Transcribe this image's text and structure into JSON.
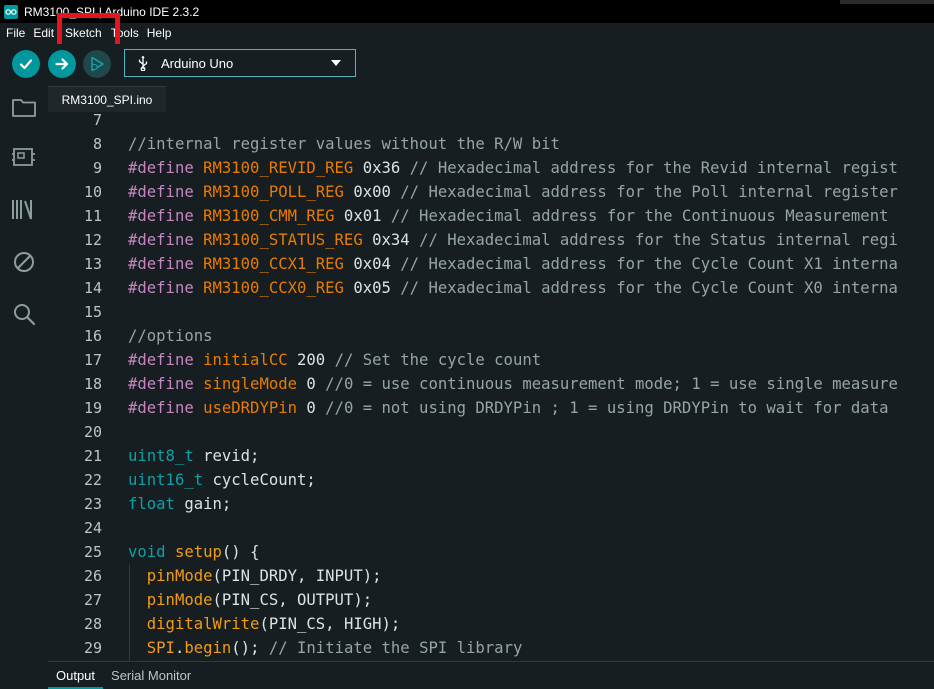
{
  "window": {
    "title": "RM3100_SPI | Arduino IDE 2.3.2"
  },
  "menu": {
    "items": [
      {
        "label": "File"
      },
      {
        "label": "Edit"
      },
      {
        "label": "Sketch"
      },
      {
        "label": "Tools"
      },
      {
        "label": "Help"
      }
    ],
    "highlighted": "Sketch"
  },
  "toolbar": {
    "verify": "verify-icon",
    "upload": "upload-arrow-icon",
    "debug": "debug-icon",
    "board": "Arduino Uno"
  },
  "sidebar": {
    "icons": [
      "folder-icon",
      "board-icon",
      "library-icon",
      "debug-icon",
      "search-icon"
    ]
  },
  "tabs": [
    {
      "label": "RM3100_SPI.ino"
    }
  ],
  "editor": {
    "lines": [
      {
        "n": "7",
        "segs": []
      },
      {
        "n": "8",
        "segs": [
          {
            "c": "cm",
            "t": "//internal register values without the R/W bit"
          }
        ]
      },
      {
        "n": "9",
        "segs": [
          {
            "c": "dir",
            "t": "#define "
          },
          {
            "c": "def",
            "t": "RM3100_REVID_REG"
          },
          {
            "c": "",
            "t": " 0x36 "
          },
          {
            "c": "cm",
            "t": "// Hexadecimal address for the Revid internal regist"
          }
        ]
      },
      {
        "n": "10",
        "segs": [
          {
            "c": "dir",
            "t": "#define "
          },
          {
            "c": "def",
            "t": "RM3100_POLL_REG"
          },
          {
            "c": "",
            "t": " 0x00 "
          },
          {
            "c": "cm",
            "t": "// Hexadecimal address for the Poll internal register"
          }
        ]
      },
      {
        "n": "11",
        "segs": [
          {
            "c": "dir",
            "t": "#define "
          },
          {
            "c": "def",
            "t": "RM3100_CMM_REG"
          },
          {
            "c": "",
            "t": " 0x01 "
          },
          {
            "c": "cm",
            "t": "// Hexadecimal address for the Continuous Measurement"
          }
        ]
      },
      {
        "n": "12",
        "segs": [
          {
            "c": "dir",
            "t": "#define "
          },
          {
            "c": "def",
            "t": "RM3100_STATUS_REG"
          },
          {
            "c": "",
            "t": " 0x34 "
          },
          {
            "c": "cm",
            "t": "// Hexadecimal address for the Status internal regi"
          }
        ]
      },
      {
        "n": "13",
        "segs": [
          {
            "c": "dir",
            "t": "#define "
          },
          {
            "c": "def",
            "t": "RM3100_CCX1_REG"
          },
          {
            "c": "",
            "t": " 0x04 "
          },
          {
            "c": "cm",
            "t": "// Hexadecimal address for the Cycle Count X1 interna"
          }
        ]
      },
      {
        "n": "14",
        "segs": [
          {
            "c": "dir",
            "t": "#define "
          },
          {
            "c": "def",
            "t": "RM3100_CCX0_REG"
          },
          {
            "c": "",
            "t": " 0x05 "
          },
          {
            "c": "cm",
            "t": "// Hexadecimal address for the Cycle Count X0 interna"
          }
        ]
      },
      {
        "n": "15",
        "segs": []
      },
      {
        "n": "16",
        "segs": [
          {
            "c": "cm",
            "t": "//options"
          }
        ]
      },
      {
        "n": "17",
        "segs": [
          {
            "c": "dir",
            "t": "#define "
          },
          {
            "c": "def",
            "t": "initialCC"
          },
          {
            "c": "",
            "t": " 200 "
          },
          {
            "c": "cm",
            "t": "// Set the cycle count"
          }
        ]
      },
      {
        "n": "18",
        "segs": [
          {
            "c": "dir",
            "t": "#define "
          },
          {
            "c": "def",
            "t": "singleMode"
          },
          {
            "c": "",
            "t": " 0 "
          },
          {
            "c": "cm",
            "t": "//0 = use continuous measurement mode; 1 = use single measure"
          }
        ]
      },
      {
        "n": "19",
        "segs": [
          {
            "c": "dir",
            "t": "#define "
          },
          {
            "c": "def",
            "t": "useDRDYPin"
          },
          {
            "c": "",
            "t": " 0 "
          },
          {
            "c": "cm",
            "t": "//0 = not using DRDYPin ; 1 = using DRDYPin to wait for data"
          }
        ]
      },
      {
        "n": "20",
        "segs": []
      },
      {
        "n": "21",
        "segs": [
          {
            "c": "kw",
            "t": "uint8_t"
          },
          {
            "c": "",
            "t": " revid;"
          }
        ]
      },
      {
        "n": "22",
        "segs": [
          {
            "c": "kw",
            "t": "uint16_t"
          },
          {
            "c": "",
            "t": " cycleCount;"
          }
        ]
      },
      {
        "n": "23",
        "segs": [
          {
            "c": "kw",
            "t": "float"
          },
          {
            "c": "",
            "t": " gain;"
          }
        ]
      },
      {
        "n": "24",
        "segs": []
      },
      {
        "n": "25",
        "segs": [
          {
            "c": "kw",
            "t": "void"
          },
          {
            "c": "",
            "t": " "
          },
          {
            "c": "fn",
            "t": "setup"
          },
          {
            "c": "",
            "t": "() {"
          }
        ]
      },
      {
        "n": "26",
        "segs": [
          {
            "c": "",
            "t": "  "
          },
          {
            "c": "fn",
            "t": "pinMode"
          },
          {
            "c": "",
            "t": "(PIN_DRDY, INPUT);"
          }
        ]
      },
      {
        "n": "27",
        "segs": [
          {
            "c": "",
            "t": "  "
          },
          {
            "c": "fn",
            "t": "pinMode"
          },
          {
            "c": "",
            "t": "(PIN_CS, OUTPUT);"
          }
        ]
      },
      {
        "n": "28",
        "segs": [
          {
            "c": "",
            "t": "  "
          },
          {
            "c": "fn",
            "t": "digitalWrite"
          },
          {
            "c": "",
            "t": "(PIN_CS, HIGH);"
          }
        ]
      },
      {
        "n": "29",
        "segs": [
          {
            "c": "",
            "t": "  "
          },
          {
            "c": "fn",
            "t": "SPI"
          },
          {
            "c": "",
            "t": "."
          },
          {
            "c": "fn",
            "t": "begin"
          },
          {
            "c": "",
            "t": "(); "
          },
          {
            "c": "cm",
            "t": "// Initiate the SPI library"
          }
        ]
      }
    ]
  },
  "bottom_panel": {
    "tabs": [
      {
        "label": "Output",
        "active": true
      },
      {
        "label": "Serial Monitor",
        "active": false
      }
    ]
  },
  "colors": {
    "accent": "#00979d",
    "highlight_box": "#e8141d",
    "background": "#171e21"
  }
}
